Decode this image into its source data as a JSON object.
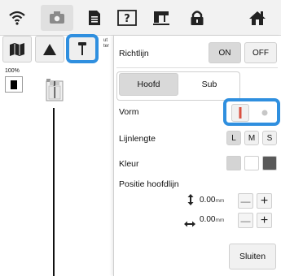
{
  "toolbar": {
    "icons": [
      "wifi-icon",
      "settings-tab-icon",
      "page-icon",
      "help-icon",
      "embroidery-icon",
      "lock-icon",
      "home-icon"
    ]
  },
  "tools": {
    "items": [
      "book-icon",
      "triangle-icon",
      "pin-icon"
    ],
    "selected": "pin-icon",
    "truncated_label_1": "ut",
    "truncated_label_2": "ter"
  },
  "zoom_label": "100%",
  "panel": {
    "title": "Richtlijn",
    "on_label": "ON",
    "off_label": "OFF",
    "tabs": {
      "main": "Hoofd",
      "sub": "Sub"
    },
    "shape": {
      "label": "Vorm",
      "line_option": "line-icon",
      "dot_option": "dot-icon"
    },
    "length": {
      "label": "Lijnlengte",
      "options": [
        "L",
        "M",
        "S"
      ],
      "selected": "L"
    },
    "color": {
      "label": "Kleur",
      "swatches": [
        "#d4d4d4",
        "#ffffff",
        "#595959"
      ]
    },
    "position": {
      "label": "Positie hoofdlijn",
      "vertical_value": "0.00",
      "vertical_unit": "mm",
      "horizontal_value": "0.00",
      "horizontal_unit": "mm",
      "minus": "—",
      "plus": "+"
    },
    "close_label": "Sluiten"
  },
  "colors": {
    "highlight": "#2f8fdf",
    "panel_button": "#f1f1f1"
  }
}
